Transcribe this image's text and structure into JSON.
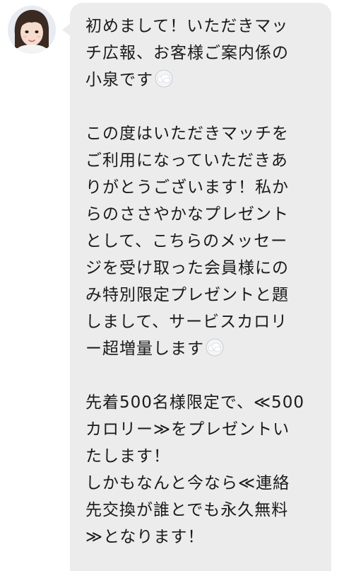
{
  "message": {
    "sender_icon": "avatar-photo",
    "emoji_icon": "cloud-emoji",
    "lines": [
      "初めまして！いただきマッ",
      "チ広報、お客様ご案内係の",
      "小泉です",
      "",
      "この度はいただきマッチを",
      "ご利用になっていただきあ",
      "りがとうございます！私か",
      "らのささやかなプレゼント",
      "として、こちらのメッセー",
      "ジを受け取った会員様にの",
      "み特別限定プレゼントと題",
      "しまして、サービスカロリ",
      "ー超増量します",
      "",
      "先着500名様限定で、≪500",
      "カロリー≫をプレゼントい",
      "たします！",
      "しかもなんと今なら≪連絡",
      "先交換が誰とでも永久無料",
      "≫となります！"
    ]
  },
  "colors": {
    "bubble": "#ececec",
    "text": "#1a1a1a",
    "background": "#ffffff"
  }
}
